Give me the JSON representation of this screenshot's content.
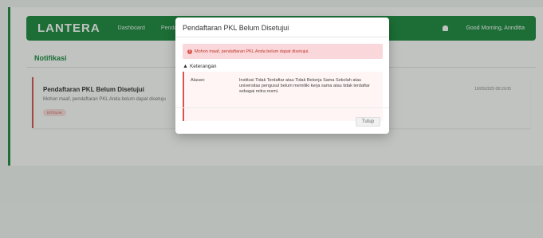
{
  "app": {
    "brand": "LANTERA",
    "nav": [
      "Dashboard",
      "Pendaftaran"
    ],
    "greeting": "Good Morning, Annditta"
  },
  "page": {
    "section_title": "Notifikasi",
    "notification": {
      "title": "Pendaftaran PKL Belum Disetujui",
      "message": "Mohon maaf, pendaftaran PKL Anda belum dapat disetuju",
      "badge": "DITOLAK",
      "time": "16/05/2025 08:19:05"
    }
  },
  "modal": {
    "title": "Pendaftaran PKL Belum Disetujui",
    "alert": "Mohon maaf, pendaftaran PKL Anda belum dapat disetujui.",
    "keterangan_label": "Keterangan",
    "reason_label": "Alasan:",
    "reason_text": "Institusi Tidak Terdaftar atau Tidak Bekerja Sama Sekolah atau universitas pengusul belum memiliki kerja sama atau tidak terdaftar sebagai mitra resmi.",
    "close_label": "Tutup"
  },
  "colors": {
    "brand_green": "#1c8a41",
    "danger": "#d9534f",
    "alert_bg": "#f9d7da"
  }
}
